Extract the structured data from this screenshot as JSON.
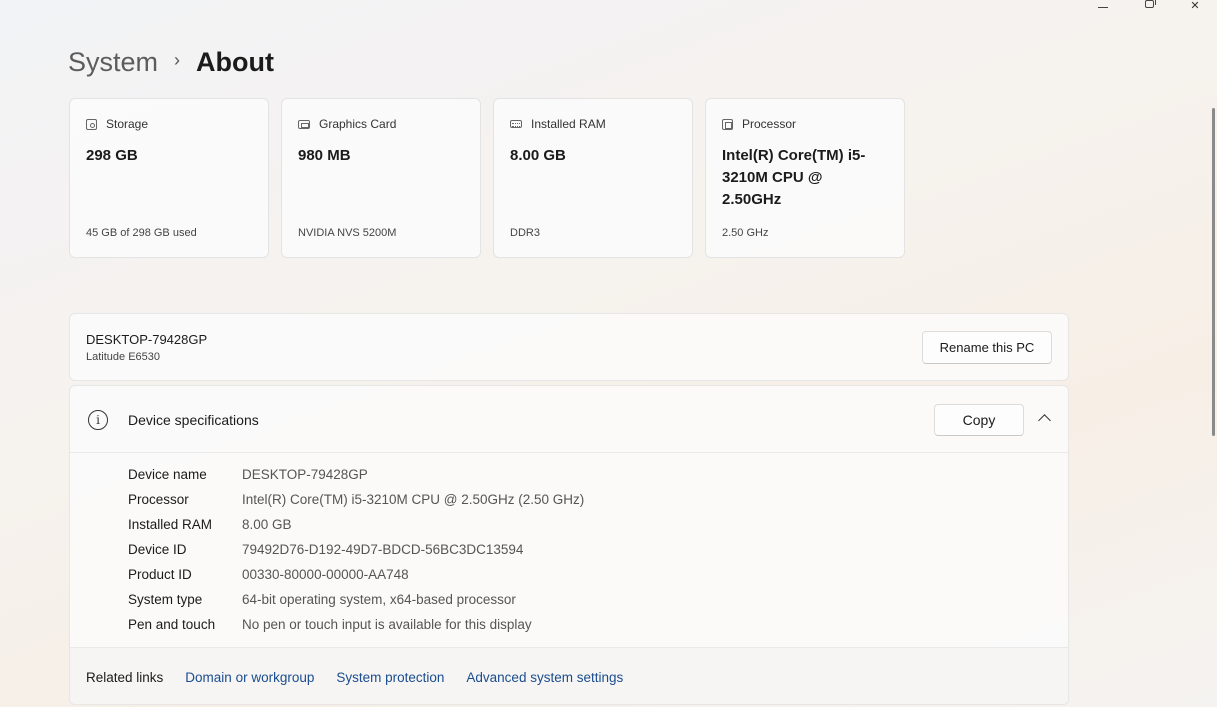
{
  "window": {
    "minimize_glyph": "",
    "close_glyph": "✕"
  },
  "breadcrumb": {
    "parent": "System",
    "separator": "›",
    "current": "About"
  },
  "cards": [
    {
      "icon": "storage-icon",
      "title": "Storage",
      "value": "298 GB",
      "sub": "45 GB of 298 GB used"
    },
    {
      "icon": "graphics-card-icon",
      "title": "Graphics Card",
      "value": "980 MB",
      "sub": "NVIDIA NVS 5200M"
    },
    {
      "icon": "ram-icon",
      "title": "Installed RAM",
      "value": "8.00 GB",
      "sub": "DDR3"
    },
    {
      "icon": "processor-icon",
      "title": "Processor",
      "value": "Intel(R) Core(TM) i5-3210M CPU @ 2.50GHz",
      "sub": "2.50 GHz"
    }
  ],
  "pc": {
    "name": "DESKTOP-79428GP",
    "model": "Latitude E6530",
    "rename_label": "Rename this PC"
  },
  "specs": {
    "title": "Device specifications",
    "info_glyph": "i",
    "copy_label": "Copy",
    "rows": [
      {
        "label": "Device name",
        "value": "DESKTOP-79428GP"
      },
      {
        "label": "Processor",
        "value": "Intel(R) Core(TM) i5-3210M CPU @ 2.50GHz (2.50 GHz)"
      },
      {
        "label": "Installed RAM",
        "value": "8.00 GB"
      },
      {
        "label": "Device ID",
        "value": "79492D76-D192-49D7-BDCD-56BC3DC13594"
      },
      {
        "label": "Product ID",
        "value": "00330-80000-00000-AA748"
      },
      {
        "label": "System type",
        "value": "64-bit operating system, x64-based processor"
      },
      {
        "label": "Pen and touch",
        "value": "No pen or touch input is available for this display"
      }
    ]
  },
  "related": {
    "title": "Related links",
    "links": [
      "Domain or workgroup",
      "System protection",
      "Advanced system settings"
    ]
  }
}
